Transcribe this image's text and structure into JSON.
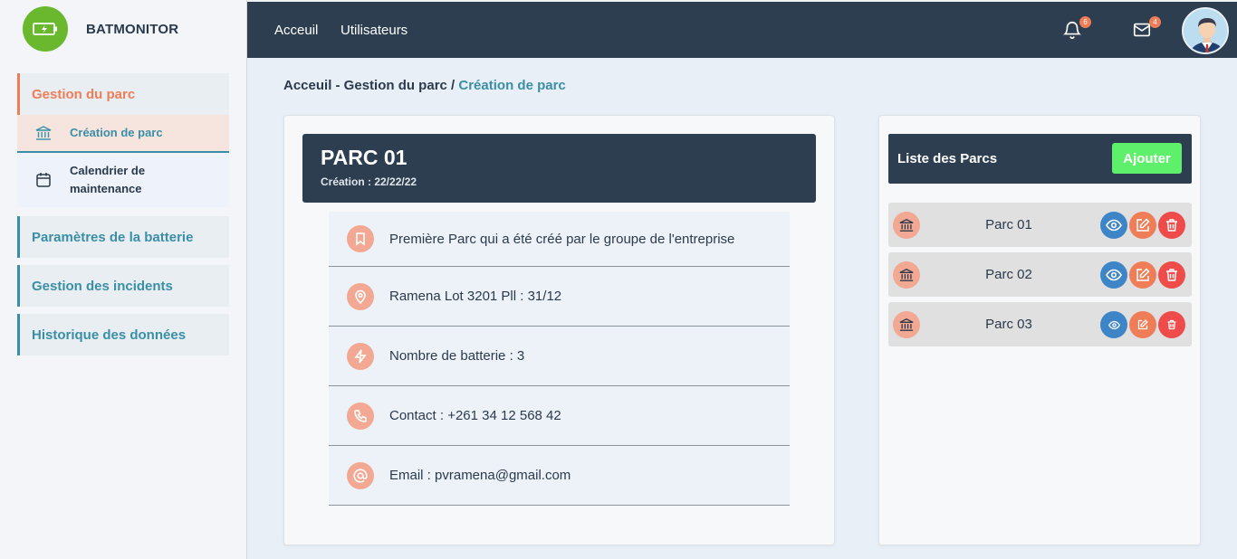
{
  "brand": {
    "name": "BATMONITOR"
  },
  "sidebar": {
    "groups": [
      {
        "label": "Gestion du parc",
        "active": true
      },
      {
        "label": "Paramètres de la batterie"
      },
      {
        "label": "Gestion des incidents"
      },
      {
        "label": "Historique des données"
      }
    ],
    "sub_items": [
      {
        "label": "Création de parc",
        "icon": "bank-icon",
        "selected": true
      },
      {
        "label": "Calendrier de maintenance",
        "icon": "calendar-icon"
      }
    ]
  },
  "topbar": {
    "nav": [
      "Acceuil",
      "Utilisateurs"
    ],
    "notifications_count": "6",
    "messages_count": "4"
  },
  "breadcrumb": {
    "path": "Acceuil - Gestion du parc /",
    "current": "Création de parc"
  },
  "detail": {
    "title": "PARC 01",
    "date": "Création : 22/22/22",
    "rows": [
      {
        "icon": "bookmark-icon",
        "text": "Première Parc qui a été créé par le groupe de l'entreprise"
      },
      {
        "icon": "location-icon",
        "text": "Ramena Lot 3201 Pll : 31/12"
      },
      {
        "icon": "bolt-icon",
        "text": "Nombre de batterie : 3"
      },
      {
        "icon": "phone-icon",
        "text": "Contact : +261 34 12 568 42"
      },
      {
        "icon": "at-icon",
        "text": "Email : pvramena@gmail.com"
      }
    ]
  },
  "list": {
    "title": "Liste des Parcs",
    "add_label": "Ajouter",
    "items": [
      {
        "name": "Parc 01"
      },
      {
        "name": "Parc 02"
      },
      {
        "name": "Parc 03"
      }
    ]
  },
  "colors": {
    "dark": "#2c3e50",
    "accent_orange": "#ef7d57",
    "accent_teal": "#3a8fa6",
    "add_green": "#5ef06a",
    "view_blue": "#3d85c6",
    "delete_red": "#ef4b4b"
  }
}
